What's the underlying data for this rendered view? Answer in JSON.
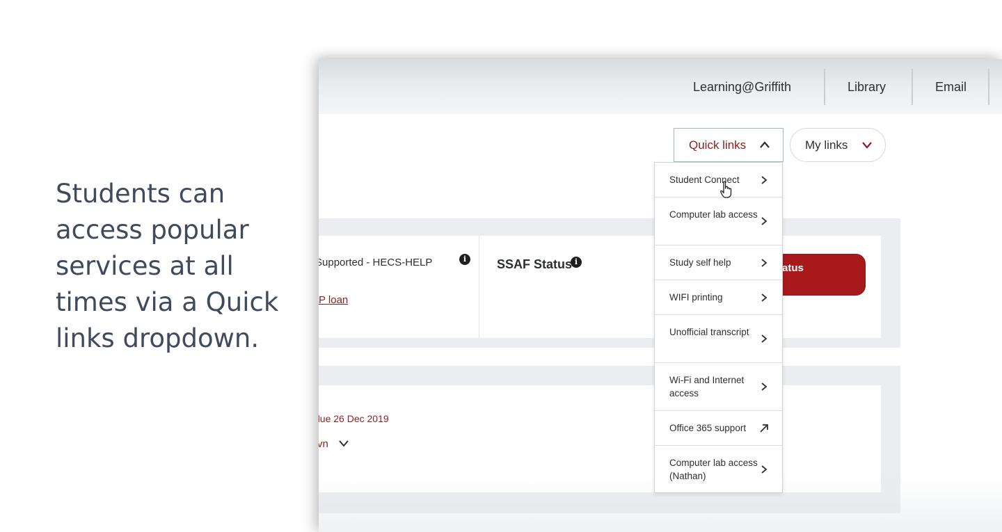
{
  "caption": "Students can access popular services at all times via a Quick links dropdown.",
  "top_nav": {
    "items": [
      "Learning@Griffith",
      "Library",
      "Email"
    ]
  },
  "quick_links_button": {
    "label": "Quick links",
    "expanded": true
  },
  "my_links_button": {
    "label": "My links"
  },
  "quick_links_menu": {
    "items": [
      {
        "label": "Student Connect",
        "icon": "chevron-right-icon"
      },
      {
        "label": "Computer lab access",
        "icon": "chevron-right-icon"
      },
      {
        "label": "Study self help",
        "icon": "chevron-right-icon"
      },
      {
        "label": "WIFI printing",
        "icon": "chevron-right-icon"
      },
      {
        "label": "Unofficial transcript",
        "icon": "chevron-right-icon"
      },
      {
        "label": "Wi-Fi and Internet access",
        "icon": "chevron-right-icon"
      },
      {
        "label": "Office 365 support",
        "icon": "external-link-icon"
      },
      {
        "label": "Computer lab access (Nathan)",
        "icon": "chevron-right-icon"
      }
    ]
  },
  "finance_card": {
    "hecs_text": "Supported - HECS-HELP",
    "loan_link": "P loan",
    "ssaf_title": "SSAF Status",
    "status_button": "tatus"
  },
  "fees_card": {
    "due_text": "due 26 Dec 2019",
    "toggle_text": "vn"
  },
  "colors": {
    "accent_red": "#a8191b",
    "link_red": "#8b1e1e",
    "text_dark": "#2c2f33",
    "caption_text": "#3f4a5c",
    "panel_grey": "#ebedf0"
  }
}
